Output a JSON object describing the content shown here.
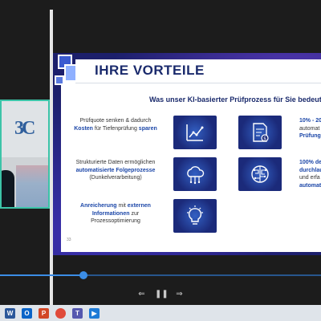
{
  "slide": {
    "title": "IHRE VORTEILE",
    "subtitle": "Was unser KI-basierter Prüfprozess für Sie bedeutet:",
    "page_number": "33",
    "items_left": [
      {
        "pre": "Prüfquote senken & dadurch ",
        "hl1": "Kosten",
        "mid": " für Tiefenprüfung ",
        "hl2": "sparen",
        "post": ""
      },
      {
        "pre": "Strukturierte Daten ermöglichen ",
        "hl1": "automatisierte Folgeprozesse",
        "mid": " (Dunkelverarbeitung)",
        "hl2": "",
        "post": ""
      },
      {
        "pre": "",
        "hl1": "Anreicherung",
        "mid": " mit ",
        "hl2": "externen Informationen",
        "post": " zur Prozessoptimierung"
      }
    ],
    "items_right": [
      {
        "line1": "10% - 20",
        "line2": "automat",
        "line3": "Prüfung"
      },
      {
        "line1": "100% de",
        "line2": "durchlau",
        "line3": "und erfa",
        "line4": "automat"
      }
    ],
    "icons": [
      "chart-growth-icon",
      "cloud-network-icon",
      "lightbulb-icon",
      "invoice-money-icon",
      "circuit-brain-icon"
    ]
  },
  "webcam": {
    "logo": "3C"
  },
  "player": {
    "progress": 0.26
  },
  "taskbar": {
    "apps": [
      {
        "name": "word-icon",
        "label": "W",
        "color": "#2b579a"
      },
      {
        "name": "outlook-icon",
        "label": "O",
        "color": "#0a64c8"
      },
      {
        "name": "powerpoint-icon",
        "label": "P",
        "color": "#d24726"
      },
      {
        "name": "chrome-icon",
        "label": "",
        "color": "#e04a3a"
      },
      {
        "name": "teams-icon",
        "label": "T",
        "color": "#5558af"
      },
      {
        "name": "media-icon",
        "label": "▶",
        "color": "#1e7bd6"
      }
    ]
  },
  "colors": {
    "slide_bg": "#1c1f6b",
    "accent": "#1c47a8",
    "webcam_border": "#3cc4a8",
    "scrub": "#3b8de6"
  }
}
